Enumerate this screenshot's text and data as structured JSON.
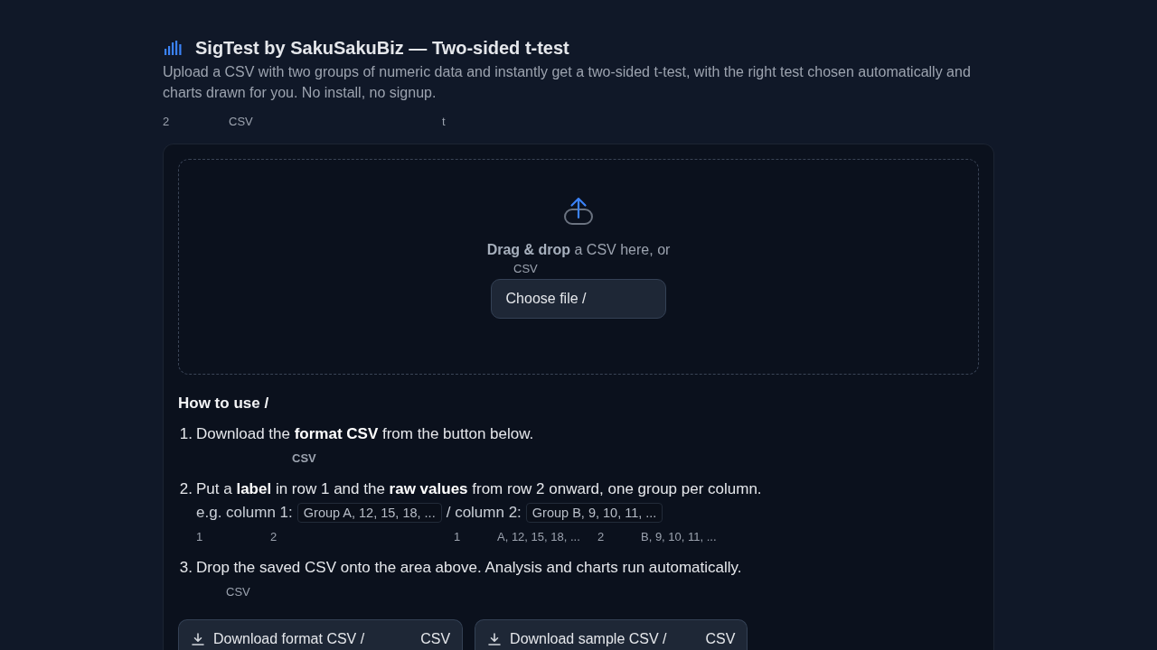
{
  "header": {
    "title": "SigTest by SakuSakuBiz — Two-sided t-test",
    "description": "Upload a CSV with two groups of numeric data and instantly get a two-sided t-test, with the right test chosen automatically and charts drawn for you. No install, no signup.",
    "note_fragments": [
      "2",
      "CSV",
      "t"
    ]
  },
  "dropzone": {
    "prompt": "**Drag & drop** a CSV here, or",
    "note_fragments": [
      "CSV"
    ],
    "button": "Choose file /"
  },
  "how_to": {
    "heading": "How to use /",
    "steps": [
      {
        "number": "1.",
        "text": "Download the **format CSV** from the button below.",
        "note_fragments": [
          "CSV"
        ]
      },
      {
        "number": "2.",
        "text": "Put a **label** in row 1 and the **raw values** from row 2 onward, one group per column.",
        "example": [
          {
            "kind": "text",
            "text": "e.g. column 1:"
          },
          {
            "kind": "code",
            "text": "Group A, 12, 15, 18, ..."
          },
          {
            "kind": "text",
            "text": "/ column 2:"
          },
          {
            "kind": "code",
            "text": "Group B, 9, 10, 11, ..."
          }
        ],
        "note_fragments": [
          "1",
          "2",
          "1",
          "A, 12, 15, 18, ...",
          "2",
          "B, 9, 10, 11, ..."
        ]
      },
      {
        "number": "3.",
        "text": "Drop the saved CSV onto the area above. Analysis and charts run automatically.",
        "note_fragments": [
          "CSV"
        ]
      }
    ]
  },
  "downloads": [
    {
      "label": "Download format CSV /",
      "note": "CSV"
    },
    {
      "label": "Download sample CSV /",
      "note": "CSV"
    }
  ]
}
